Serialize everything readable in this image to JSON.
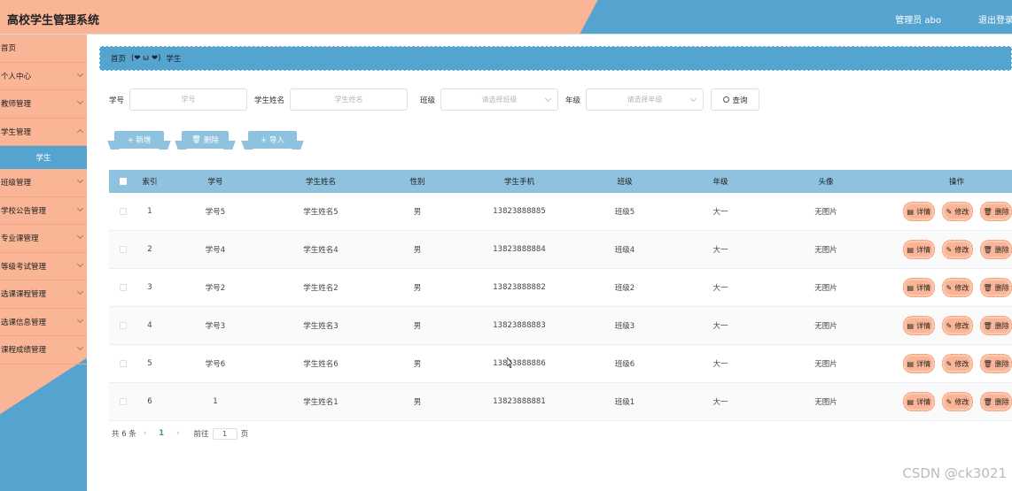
{
  "header": {
    "title": "高校学生管理系统",
    "admin": "管理员 abo",
    "logout": "退出登录"
  },
  "sidebar": {
    "items": [
      {
        "label": "首页",
        "has_chevron": false
      },
      {
        "label": "个人中心",
        "has_chevron": true
      },
      {
        "label": "教师管理",
        "has_chevron": true
      },
      {
        "label": "学生管理",
        "has_chevron": true
      },
      {
        "label": "班级管理",
        "has_chevron": true
      },
      {
        "label": "学校公告管理",
        "has_chevron": true
      },
      {
        "label": "专业课管理",
        "has_chevron": true
      },
      {
        "label": "等级考试管理",
        "has_chevron": true
      },
      {
        "label": "选课课程管理",
        "has_chevron": true
      },
      {
        "label": "选课信息管理",
        "has_chevron": true
      },
      {
        "label": "课程成绩管理",
        "has_chevron": true
      }
    ],
    "submenu_active": "学生"
  },
  "breadcrumb": {
    "home": "首页",
    "separator": "(❤ ω ❤)",
    "current": "学生"
  },
  "search": {
    "student_no_label": "学号",
    "student_no_placeholder": "学号",
    "student_name_label": "学生姓名",
    "student_name_placeholder": "学生姓名",
    "class_label": "班级",
    "class_placeholder": "请选择班级",
    "grade_label": "年级",
    "grade_placeholder": "请选择年级",
    "query_button": "查询"
  },
  "actions": {
    "add": "+ 新增",
    "delete": "删除",
    "import": "+ 导入"
  },
  "table": {
    "headers": [
      "索引",
      "学号",
      "学生姓名",
      "性别",
      "学生手机",
      "班级",
      "年级",
      "头像",
      "操作"
    ],
    "rows": [
      {
        "index": "1",
        "no": "学号5",
        "name": "学生姓名5",
        "sex": "男",
        "phone": "13823888885",
        "class": "班级5",
        "grade": "大一",
        "avatar": "无图片"
      },
      {
        "index": "2",
        "no": "学号4",
        "name": "学生姓名4",
        "sex": "男",
        "phone": "13823888884",
        "class": "班级4",
        "grade": "大一",
        "avatar": "无图片"
      },
      {
        "index": "3",
        "no": "学号2",
        "name": "学生姓名2",
        "sex": "男",
        "phone": "13823888882",
        "class": "班级2",
        "grade": "大一",
        "avatar": "无图片"
      },
      {
        "index": "4",
        "no": "学号3",
        "name": "学生姓名3",
        "sex": "男",
        "phone": "13823888883",
        "class": "班级3",
        "grade": "大一",
        "avatar": "无图片"
      },
      {
        "index": "5",
        "no": "学号6",
        "name": "学生姓名6",
        "sex": "男",
        "phone": "13823888886",
        "class": "班级6",
        "grade": "大一",
        "avatar": "无图片"
      },
      {
        "index": "6",
        "no": "1",
        "name": "学生姓名1",
        "sex": "男",
        "phone": "13823888881",
        "class": "班级1",
        "grade": "大一",
        "avatar": "无图片"
      }
    ],
    "op_detail": "详情",
    "op_edit": "修改",
    "op_delete": "删除"
  },
  "pagination": {
    "total": "共 6 条",
    "current_page": "1",
    "goto_label": "前往",
    "goto_value": "1",
    "page_suffix": "页"
  },
  "watermark": "CSDN @ck3021",
  "colors": {
    "accent_orange": "#f9b596",
    "accent_blue": "#55a4cf",
    "header_row_blue": "#8ec2df"
  }
}
